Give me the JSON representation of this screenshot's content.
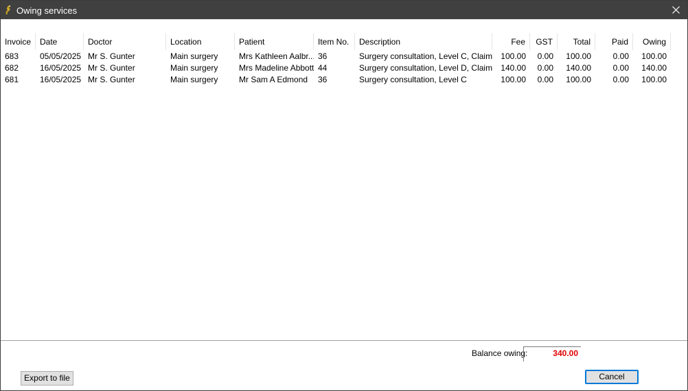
{
  "window": {
    "title": "Owing services"
  },
  "table": {
    "columns": [
      {
        "label": "Invoice"
      },
      {
        "label": "Date"
      },
      {
        "label": "Doctor"
      },
      {
        "label": "Location"
      },
      {
        "label": "Patient"
      },
      {
        "label": "Item No."
      },
      {
        "label": "Description"
      },
      {
        "label": "Fee"
      },
      {
        "label": "GST"
      },
      {
        "label": "Total"
      },
      {
        "label": "Paid"
      },
      {
        "label": "Owing"
      }
    ],
    "rows": [
      [
        "683",
        "05/05/2025",
        "Mr S. Gunter",
        "Main surgery",
        "Mrs Kathleen Aalbr...",
        "36",
        "Surgery consultation, Level C, Claim ...",
        "100.00",
        "0.00",
        "100.00",
        "0.00",
        "100.00"
      ],
      [
        "682",
        "16/05/2025",
        "Mr S. Gunter",
        "Main surgery",
        "Mrs Madeline Abbott",
        "44",
        "Surgery consultation, Level D, Claim ...",
        "140.00",
        "0.00",
        "140.00",
        "0.00",
        "140.00"
      ],
      [
        "681",
        "16/05/2025",
        "Mr S. Gunter",
        "Main surgery",
        "Mr Sam A Edmond",
        "36",
        "Surgery consultation, Level C",
        "100.00",
        "0.00",
        "100.00",
        "0.00",
        "100.00"
      ]
    ]
  },
  "footer": {
    "balance_label": "Balance owing:",
    "balance_value": "340.00",
    "export_label": "Export to file",
    "cancel_label": "Cancel"
  },
  "colors": {
    "titlebar": "#404040",
    "balance_text": "#e00000",
    "focus_border": "#0078d7"
  },
  "icons": {
    "app": "app-logo-icon",
    "close": "close-icon"
  }
}
